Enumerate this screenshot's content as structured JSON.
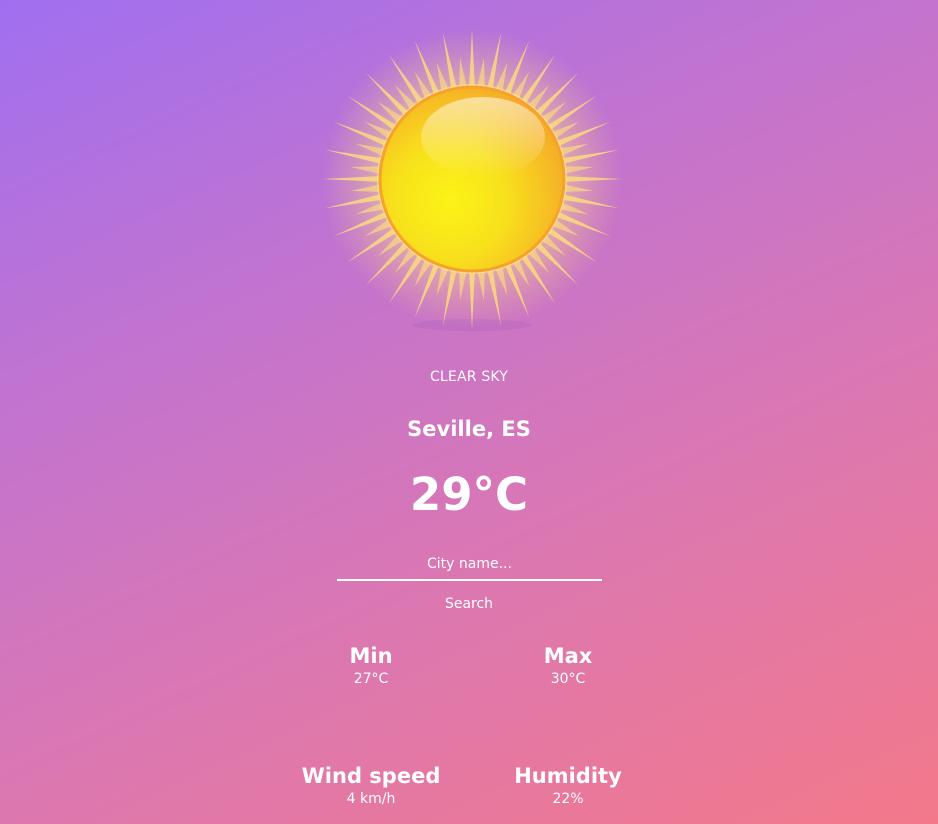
{
  "weather": {
    "icon": "sun-icon",
    "condition": "CLEAR SKY",
    "city": "Seville, ES",
    "temperature": "29°C"
  },
  "search": {
    "placeholder": "City name...",
    "value": "",
    "button_label": "Search"
  },
  "stats": {
    "min": {
      "label": "Min",
      "value": "27°C"
    },
    "max": {
      "label": "Max",
      "value": "30°C"
    },
    "wind": {
      "label": "Wind speed",
      "value": "4 km/h"
    },
    "humidity": {
      "label": "Humidity",
      "value": "22%"
    }
  },
  "colors": {
    "background_start": "#a06ff0",
    "background_end": "#f3798a",
    "text": "#ffffff",
    "sun_core": "#f7ea1a",
    "sun_edge": "#f5a623"
  }
}
